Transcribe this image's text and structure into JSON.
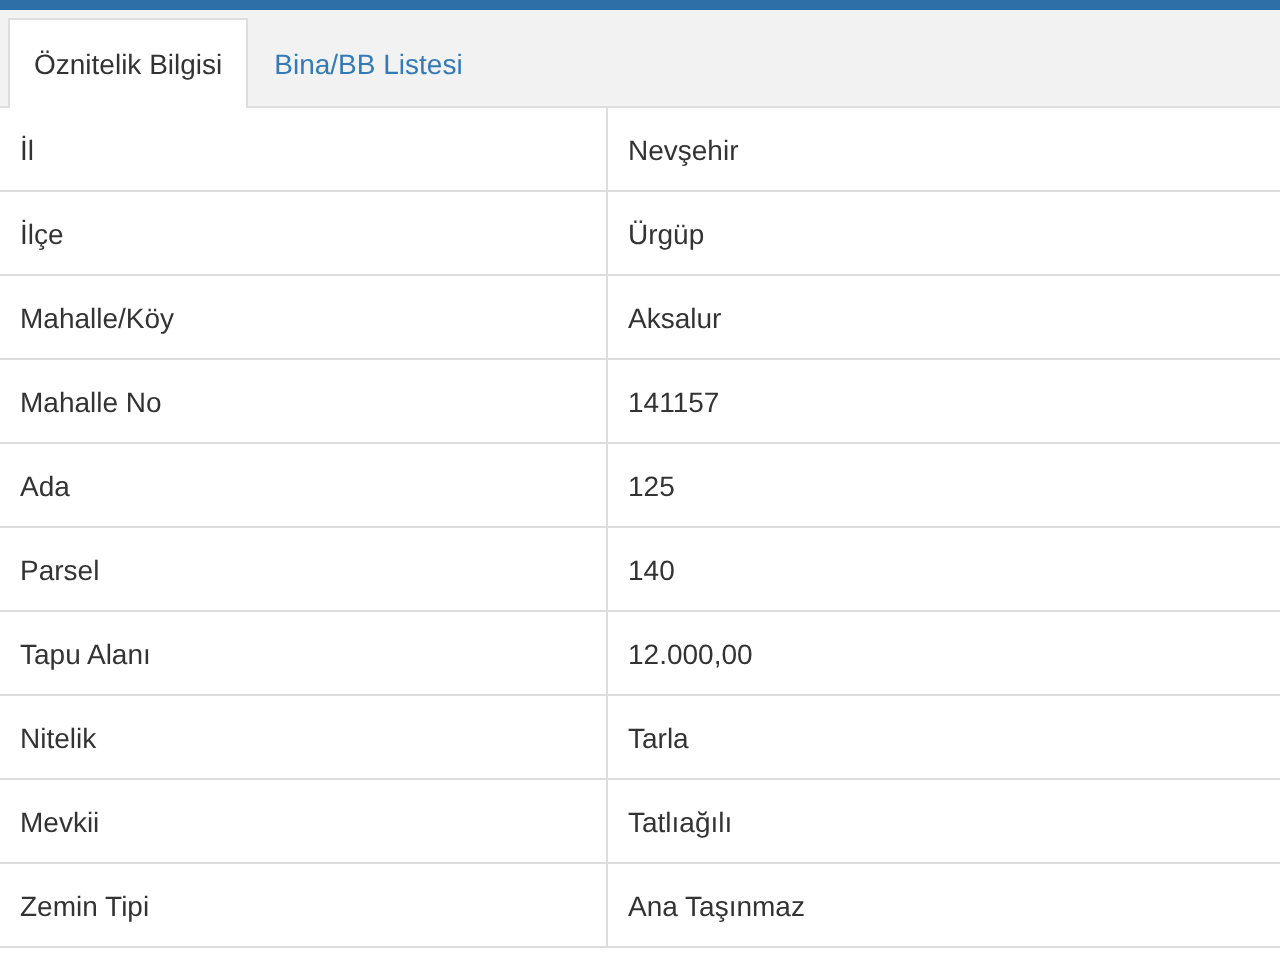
{
  "tabs": [
    {
      "label": "Öznitelik Bilgisi",
      "selected": true
    },
    {
      "label": "Bina/BB Listesi",
      "selected": false
    }
  ],
  "table": {
    "rows": [
      {
        "label": "İl",
        "value": "Nevşehir"
      },
      {
        "label": "İlçe",
        "value": "Ürgüp"
      },
      {
        "label": "Mahalle/Köy",
        "value": "Aksalur"
      },
      {
        "label": "Mahalle No",
        "value": "141157"
      },
      {
        "label": "Ada",
        "value": "125"
      },
      {
        "label": "Parsel",
        "value": "140"
      },
      {
        "label": "Tapu Alanı",
        "value": "12.000,00"
      },
      {
        "label": "Nitelik",
        "value": "Tarla"
      },
      {
        "label": "Mevkii",
        "value": "Tatlıağılı"
      },
      {
        "label": "Zemin Tipi",
        "value": "Ana Taşınmaz"
      }
    ]
  }
}
